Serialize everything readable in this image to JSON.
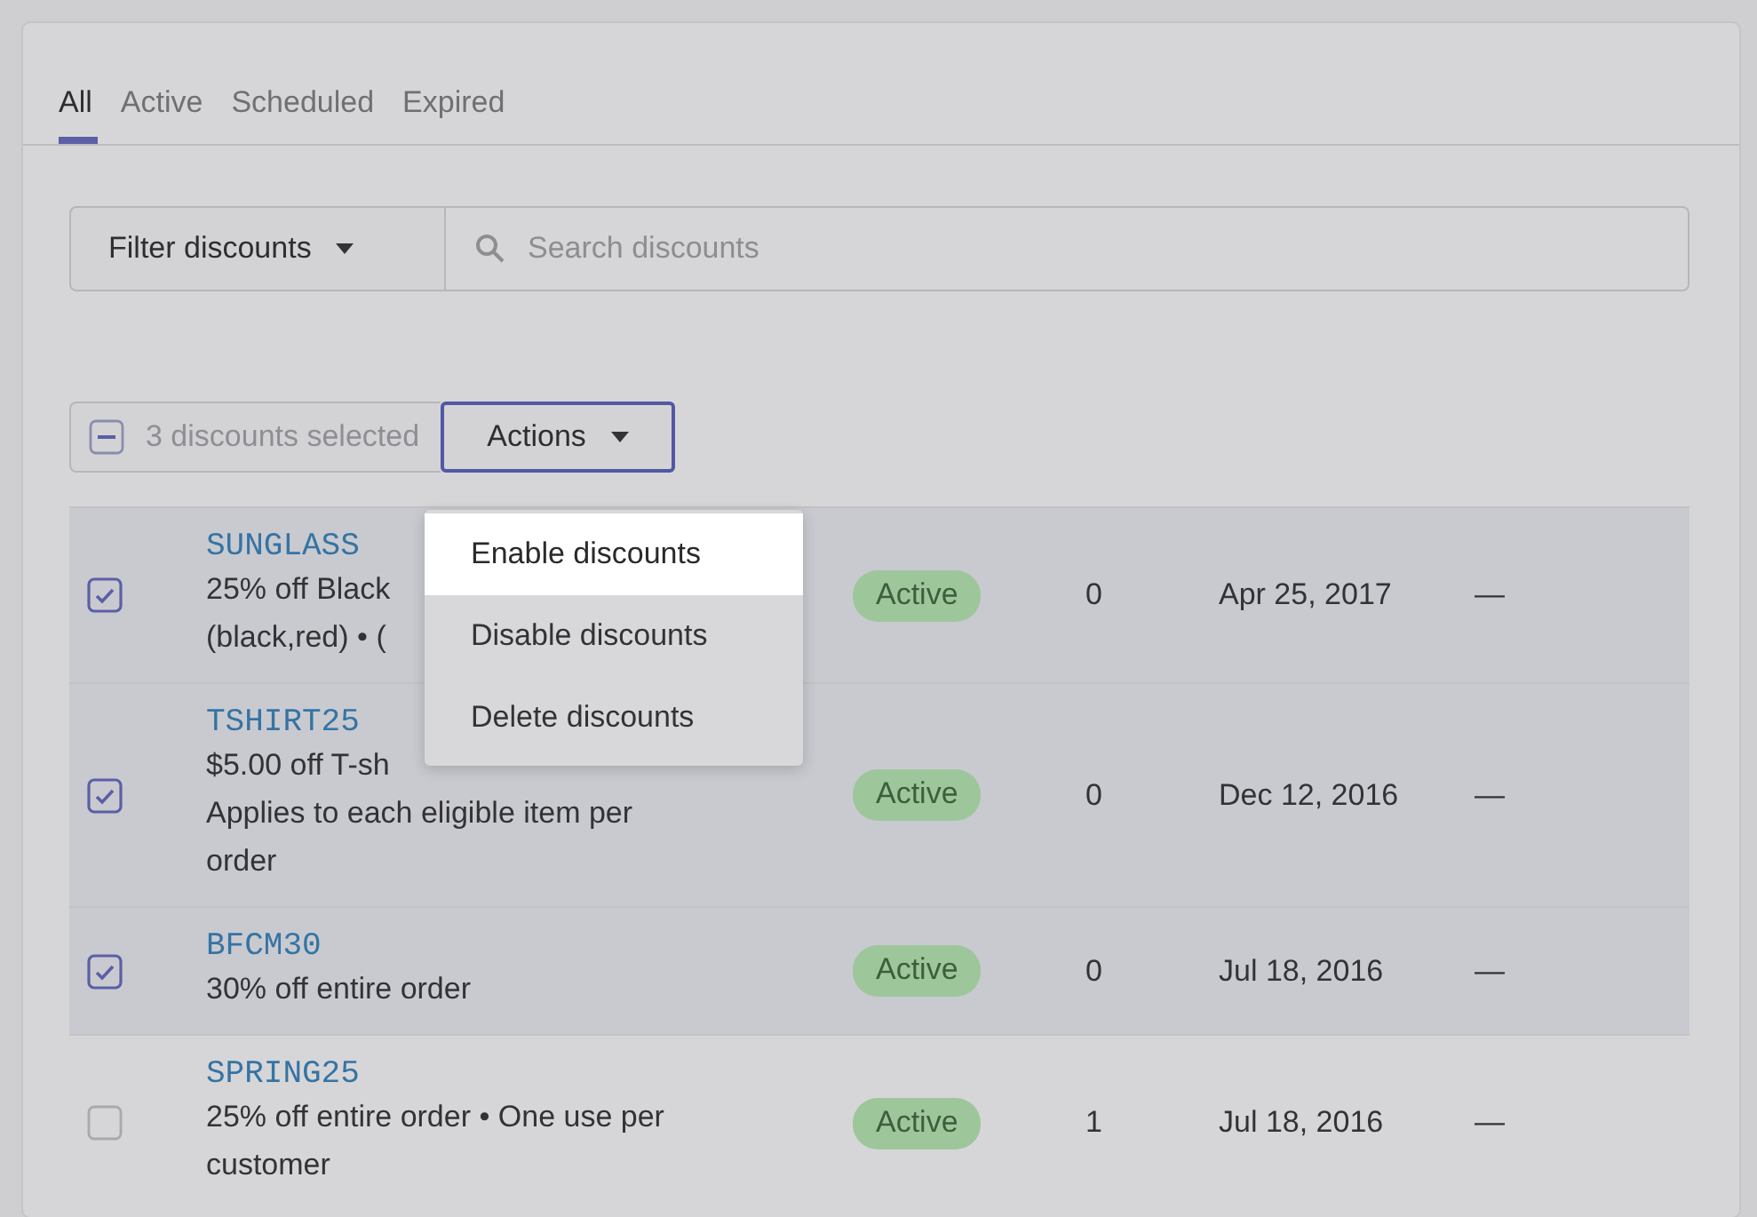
{
  "tabs": [
    {
      "label": "All",
      "selected": true
    },
    {
      "label": "Active",
      "selected": false
    },
    {
      "label": "Scheduled",
      "selected": false
    },
    {
      "label": "Expired",
      "selected": false
    }
  ],
  "filter": {
    "button": "Filter discounts",
    "search_placeholder": "Search discounts"
  },
  "bulk": {
    "partially_selected": true,
    "label": "3 discounts selected",
    "actions_button": "Actions"
  },
  "actions_menu": [
    {
      "label": "Enable discounts",
      "selected": true
    },
    {
      "label": "Disable discounts",
      "selected": false
    },
    {
      "label": "Delete discounts",
      "selected": false
    }
  ],
  "discounts": [
    {
      "selected": true,
      "code": "SUNGLASS",
      "description_lines": [
        "25% off Black",
        "(black,red) • ("
      ],
      "status": "Active",
      "uses": "0",
      "start": "Apr 25, 2017",
      "end": "—"
    },
    {
      "selected": true,
      "code": "TSHIRT25",
      "description_lines": [
        "$5.00 off T-sh",
        "Applies to each eligible item per",
        "order"
      ],
      "status": "Active",
      "uses": "0",
      "start": "Dec 12, 2016",
      "end": "—"
    },
    {
      "selected": true,
      "code": "BFCM30",
      "description_lines": [
        "30% off entire order"
      ],
      "status": "Active",
      "uses": "0",
      "start": "Jul 18, 2016",
      "end": "—"
    },
    {
      "selected": false,
      "code": "SPRING25",
      "description_lines": [
        "25% off entire order • One use per",
        "customer"
      ],
      "status": "Active",
      "uses": "1",
      "start": "Jul 18, 2016",
      "end": "—"
    }
  ]
}
